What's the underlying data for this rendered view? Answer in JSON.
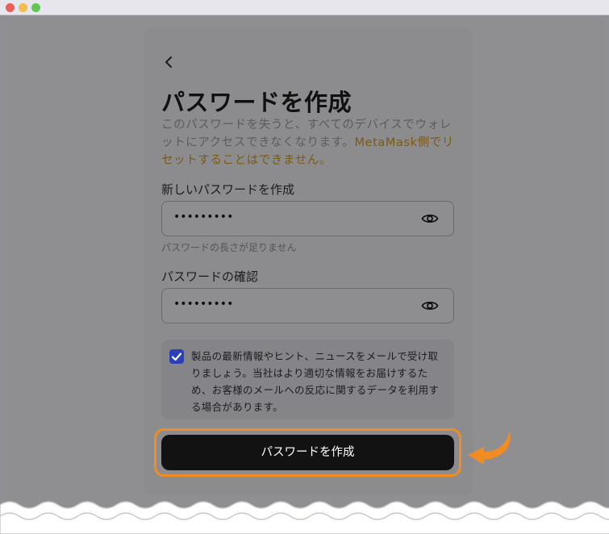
{
  "window": {
    "colors": {
      "close": "#ed5f57",
      "minimize": "#f4bd4f",
      "zoom": "#5fc653"
    }
  },
  "page": {
    "back_icon": "chevron-left-icon",
    "title": "パスワードを作成",
    "description_plain": "このパスワードを失うと、すべてのデバイスでウォレットにアクセスできなくなります。",
    "description_warning": "MetaMask側でリセットすることはできません。",
    "new_password": {
      "label": "新しいパスワードを作成",
      "value": "•••••••••",
      "toggle_icon": "eye-icon",
      "hint": "パスワードの長さが足りません"
    },
    "confirm_password": {
      "label": "パスワードの確認",
      "value": "•••••••••",
      "toggle_icon": "eye-icon"
    },
    "consent": {
      "checked": true,
      "text": "製品の最新情報やヒント、ニュースをメールで受け取りましょう。当社はより適切な情報をお届けするため、お客様のメールへの反応に関するデータを利用する場合があります。"
    },
    "submit_label": "パスワードを作成"
  },
  "annotation": {
    "highlight_color": "#f08c22",
    "arrow_icon": "curved-arrow-icon"
  }
}
